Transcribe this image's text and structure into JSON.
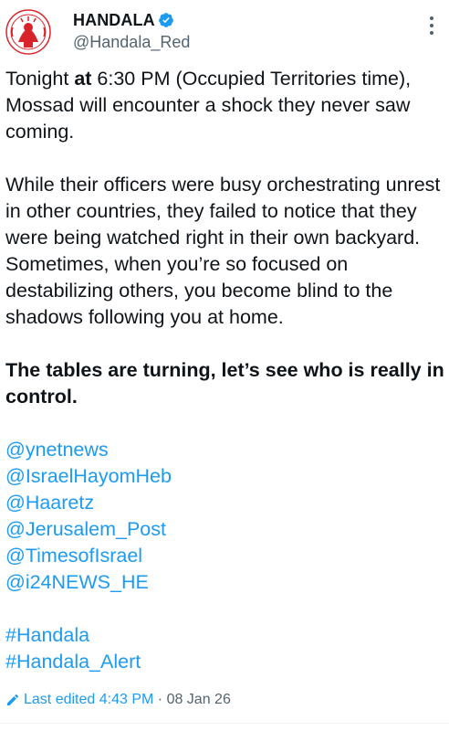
{
  "author": {
    "display_name": "HANDALA",
    "handle": "@Handala_Red",
    "avatar_text": "HANDALA",
    "verified_icon": "verified-badge-icon",
    "accent": "#1d9bf0"
  },
  "tweet": {
    "p1_a": "Tonight ",
    "p1_b": "at",
    "p1_c": " 6:30 PM",
    "p1_d": " (Occupied Territories time), Mossad will encounter a shock they never saw coming.",
    "p2": "While their officers were busy orchestrating unrest in other countries, they failed to notice that they were being watched right in their own backyard. Sometimes, when you’re so focused on destabilizing others, you become blind to the shadows following you at home.",
    "p3": "The tables are turning, let’s see who is really in control.",
    "mentions": [
      "@ynetnews",
      "@IsraelHayomHeb",
      "@Haaretz",
      "@Jerusalem_Post",
      "@TimesofIsrael",
      "@i24NEWS_HE"
    ],
    "hashtags": [
      "#Handala",
      "#Handala_Alert"
    ]
  },
  "meta": {
    "edited_label": "Last edited",
    "time": "4:43 PM",
    "separator": "·",
    "date": "08 Jan 26"
  },
  "icons": {
    "more": "more-vertical-icon",
    "edit": "pencil-icon"
  },
  "colors": {
    "text": "#0f1419",
    "muted": "#536471",
    "link": "#1d9bf0",
    "avatar_red": "#d8232a"
  }
}
